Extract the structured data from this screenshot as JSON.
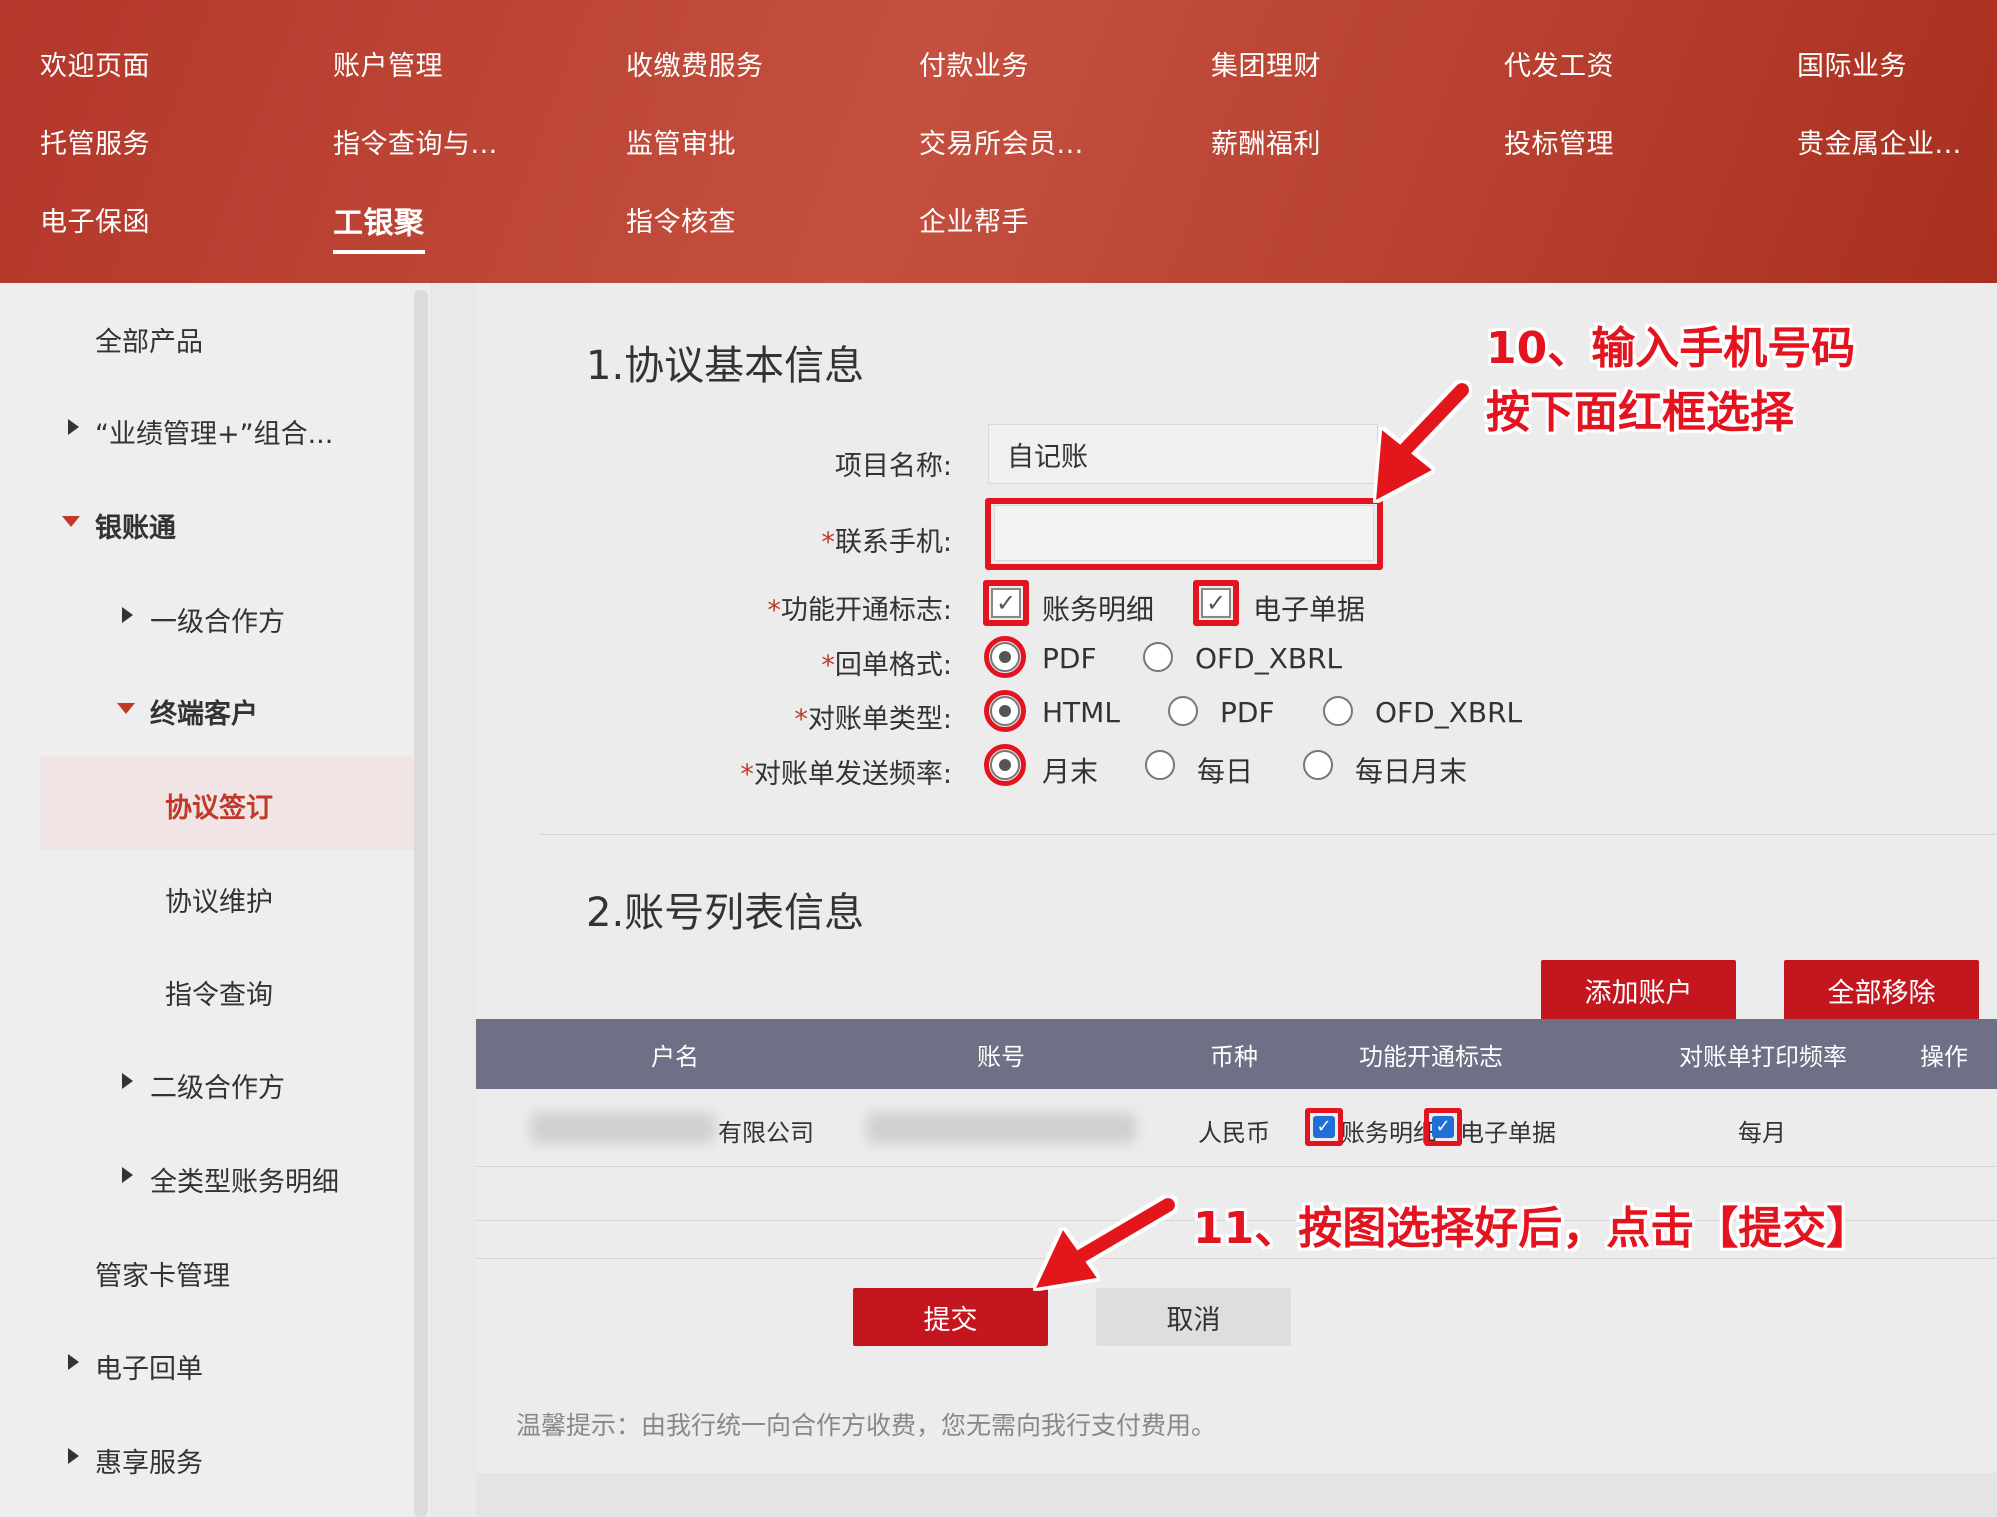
{
  "topnav": {
    "items": [
      {
        "label": "欢迎页面"
      },
      {
        "label": "账户管理"
      },
      {
        "label": "收缴费服务"
      },
      {
        "label": "付款业务"
      },
      {
        "label": "集团理财"
      },
      {
        "label": "代发工资"
      },
      {
        "label": "国际业务"
      },
      {
        "label": "托管服务"
      },
      {
        "label": "指令查询与..."
      },
      {
        "label": "监管审批"
      },
      {
        "label": "交易所会员..."
      },
      {
        "label": "薪酬福利"
      },
      {
        "label": "投标管理"
      },
      {
        "label": "贵金属企业..."
      },
      {
        "label": "电子保函"
      },
      {
        "label": "工银聚",
        "active": true
      },
      {
        "label": "指令核查"
      },
      {
        "label": "企业帮手"
      }
    ]
  },
  "sidebar": {
    "items": [
      {
        "label": "全部产品"
      },
      {
        "label": "“业绩管理+”组合..."
      },
      {
        "label": "银账通"
      },
      {
        "label": "一级合作方"
      },
      {
        "label": "终端客户"
      },
      {
        "label": "协议签订"
      },
      {
        "label": "协议维护"
      },
      {
        "label": "指令查询"
      },
      {
        "label": "二级合作方"
      },
      {
        "label": "全类型账务明细"
      },
      {
        "label": "管家卡管理"
      },
      {
        "label": "电子回单"
      },
      {
        "label": "惠享服务"
      }
    ]
  },
  "section1": {
    "title": "1.协议基本信息",
    "project_label": "项目名称:",
    "project_value": "自记账",
    "phone_label": "联系手机:",
    "phone_value": "",
    "func_label": "功能开通标志:",
    "func_options": [
      "账务明细",
      "电子单据"
    ],
    "receipt_label": "回单格式:",
    "receipt_options": [
      "PDF",
      "OFD_XBRL"
    ],
    "statement_type_label": "对账单类型:",
    "statement_type_options": [
      "HTML",
      "PDF",
      "OFD_XBRL"
    ],
    "freq_label": "对账单发送频率:",
    "freq_options": [
      "月末",
      "每日",
      "每日月末"
    ],
    "required_mark": "*"
  },
  "section2": {
    "title": "2.账号列表信息",
    "add_button": "添加账户",
    "remove_all_button": "全部移除",
    "columns": [
      "户名",
      "账号",
      "币种",
      "功能开通标志",
      "对账单打印频率",
      "操作"
    ],
    "row": {
      "name_suffix": "有限公司",
      "currency": "人民币",
      "func": [
        "账务明细",
        "电子单据"
      ],
      "freq": "每月"
    }
  },
  "actions": {
    "submit": "提交",
    "cancel": "取消",
    "tip": "温馨提示：由我行统一向合作方收费，您无需向我行支付费用。"
  },
  "annotations": {
    "step10_line1": "10、输入手机号码",
    "step10_line2": "按下面红框选择",
    "step11": "11、按图选择好后，点击【提交】"
  },
  "colors": {
    "nav_red": "#b3372a",
    "accent_red": "#c4161f",
    "annotation_red": "#e3141f",
    "table_header": "#6f6f86"
  }
}
